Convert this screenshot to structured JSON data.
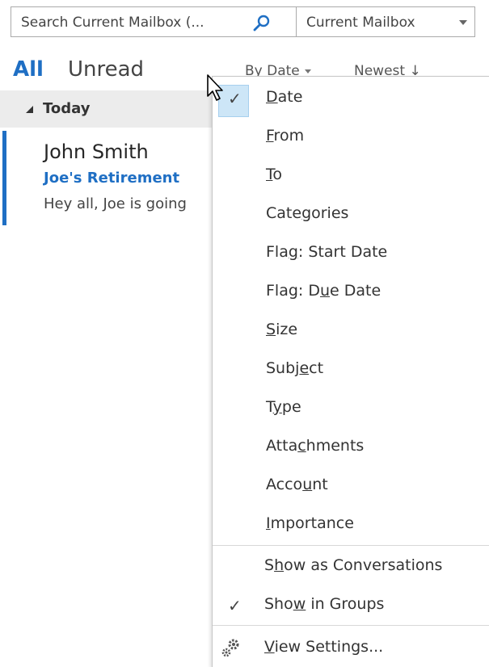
{
  "search": {
    "placeholder": "Search Current Mailbox (...",
    "scope": "Current Mailbox"
  },
  "filters": {
    "all": "All",
    "unread": "Unread",
    "sort_by": "By Date",
    "order": "Newest ↓"
  },
  "group": {
    "label": "Today"
  },
  "message": {
    "sender": "John Smith",
    "subject": "Joe's Retirement",
    "preview": "Hey all,   Joe is going"
  },
  "menu": {
    "items": [
      {
        "pre": "",
        "key": "D",
        "post": "ate",
        "checked": true
      },
      {
        "pre": "",
        "key": "F",
        "post": "rom",
        "checked": false
      },
      {
        "pre": "",
        "key": "T",
        "post": "o",
        "checked": false
      },
      {
        "pre": "Cate",
        "key": "g",
        "post": "ories",
        "checked": false
      },
      {
        "pre": "Fla",
        "key": "g",
        "post": ": Start Date",
        "checked": false
      },
      {
        "pre": "Flag: D",
        "key": "u",
        "post": "e Date",
        "checked": false
      },
      {
        "pre": "",
        "key": "S",
        "post": "ize",
        "checked": false
      },
      {
        "pre": "Subj",
        "key": "e",
        "post": "ct",
        "checked": false
      },
      {
        "pre": "T",
        "key": "y",
        "post": "pe",
        "checked": false
      },
      {
        "pre": "Atta",
        "key": "c",
        "post": "hments",
        "checked": false
      },
      {
        "pre": "Acco",
        "key": "u",
        "post": "nt",
        "checked": false
      },
      {
        "pre": "",
        "key": "I",
        "post": "mportance",
        "checked": false
      }
    ],
    "show_conversations": {
      "pre": "S",
      "key": "h",
      "post": "ow as Conversations",
      "checked": false
    },
    "show_in_groups": {
      "pre": "Sho",
      "key": "w",
      "post": " in Groups",
      "checked": true
    },
    "view_settings": {
      "pre": "",
      "key": "V",
      "post": "iew Settings...",
      "checked": false
    }
  },
  "colors": {
    "accent": "#1f6fc4",
    "check_highlight": "#cde6f7"
  }
}
